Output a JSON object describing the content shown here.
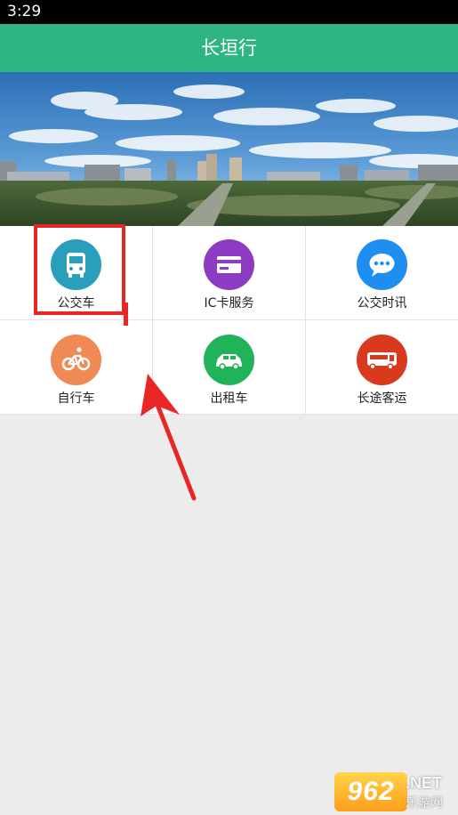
{
  "status_bar": {
    "time": "3:29"
  },
  "app_bar": {
    "title": "长垣行",
    "color": "#2eb581"
  },
  "banner": {
    "description_icon": "city-skyline-photo"
  },
  "services": [
    {
      "label": "公交车",
      "icon": "bus-icon",
      "color": "#2a9fbc"
    },
    {
      "label": "IC卡服务",
      "icon": "card-icon",
      "color": "#8e3bc4"
    },
    {
      "label": "公交时讯",
      "icon": "chat-bubble-icon",
      "color": "#1e8ff0"
    },
    {
      "label": "自行车",
      "icon": "bicycle-icon",
      "color": "#f08a55"
    },
    {
      "label": "出租车",
      "icon": "taxi-icon",
      "color": "#21b35a"
    },
    {
      "label": "长途客运",
      "icon": "coach-icon",
      "color": "#d9391d"
    }
  ],
  "annotation": {
    "highlight_color": "#e82626"
  },
  "watermark": {
    "logo": "962",
    "net": ".NET",
    "site": "乐游网"
  }
}
